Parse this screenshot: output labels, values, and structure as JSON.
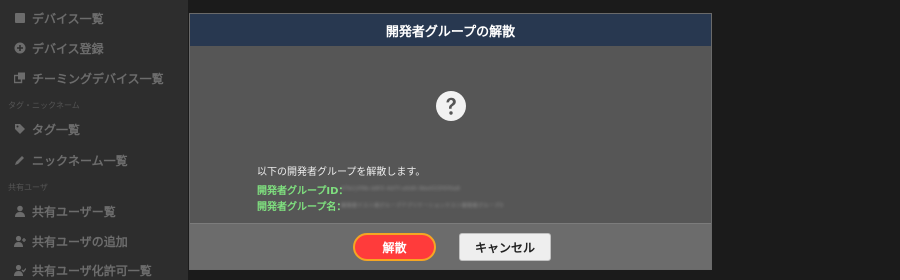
{
  "sidebar": {
    "items": [
      {
        "label": "デバイス一覧",
        "icon": "list-icon"
      },
      {
        "label": "デバイス登録",
        "icon": "plus-circle-icon"
      },
      {
        "label": "チーミングデバイス一覧",
        "icon": "copy-icon"
      },
      {
        "label": "タグ一覧",
        "icon": "tags-icon"
      },
      {
        "label": "ニックネーム一覧",
        "icon": "pencil-icon"
      },
      {
        "label": "共有ユーザー覧",
        "icon": "user-icon"
      },
      {
        "label": "共有ユーザの追加",
        "icon": "user-plus-icon"
      },
      {
        "label": "共有ユーザ化許可一覧",
        "icon": "user-check-icon"
      }
    ],
    "sections": [
      "タグ・ニックネーム",
      "共有ユーザ"
    ]
  },
  "modal": {
    "title": "開発者グループの解散",
    "icon": "question-circle-icon",
    "message": "以下の開発者グループを解散します。",
    "fields": [
      {
        "label": "開発者グループID：",
        "value": "07b12f9b-b8f3-4d7f-a0d0-9be033f0f0a8"
      },
      {
        "label": "開発者グループ名：",
        "value": "開発者テスト用グループアプリケーションテスト開発者グループ3"
      }
    ],
    "buttons": {
      "disband": "解散",
      "cancel": "キャンセル"
    }
  },
  "colors": {
    "header_bg": "#283850",
    "danger": "#ff3b3b",
    "highlight_ring": "#f5a623",
    "field_label": "#7fe07f"
  }
}
